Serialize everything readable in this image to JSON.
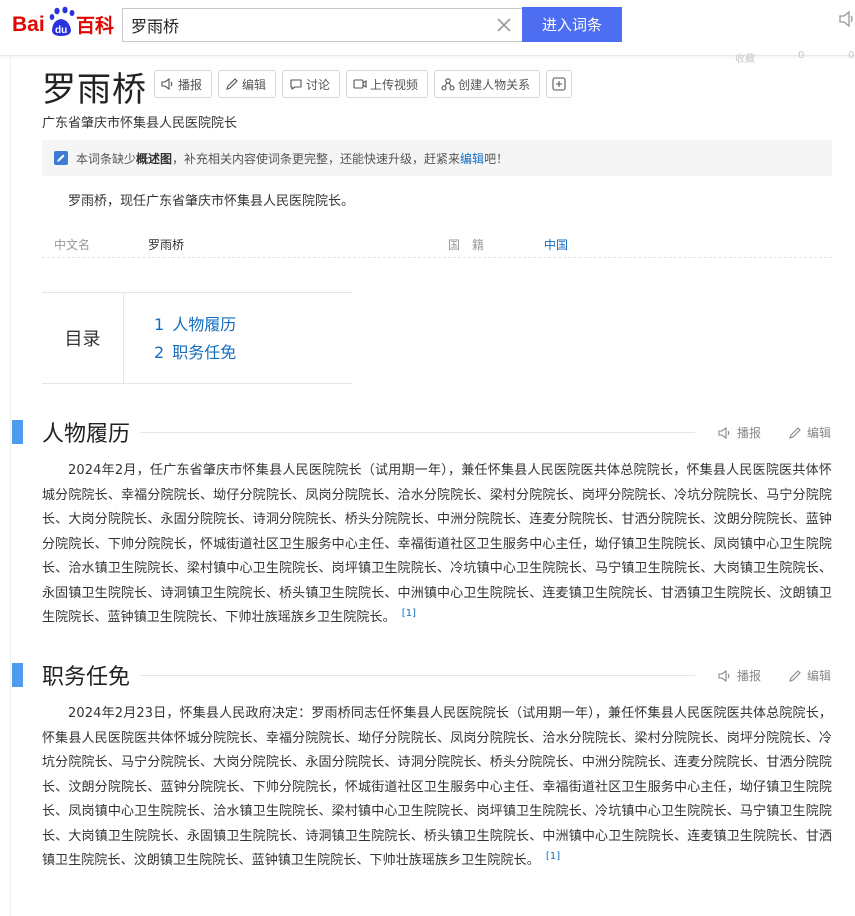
{
  "header": {
    "logo_text_bai": "Bai",
    "logo_text_du": "du",
    "logo_text_baike": "百科",
    "search_value": "罗雨桥",
    "enter_button": "进入词条"
  },
  "top_faint": {
    "collect": "收藏",
    "like_count": "0",
    "share_count": "0"
  },
  "entry": {
    "title": "罗雨桥",
    "tools": [
      "播报",
      "编辑",
      "讨论",
      "上传视频",
      "创建人物关系"
    ],
    "subtitle": "广东省肇庆市怀集县人民医院院长",
    "notice_pre": "本词条缺少",
    "notice_bold": "概述图",
    "notice_mid": "，补充相关内容使词条更完整，还能快速升级，赶紧来",
    "notice_link": "编辑",
    "notice_post": "吧！",
    "summary": "罗雨桥，现任广东省肇庆市怀集县人民医院院长。",
    "info": {
      "k1": "中文名",
      "v1": "罗雨桥",
      "k2": "国　籍",
      "v2": "中国"
    }
  },
  "toc": {
    "label": "目录",
    "items": [
      {
        "num": "1",
        "text": "人物履历"
      },
      {
        "num": "2",
        "text": "职务任免"
      }
    ]
  },
  "sections": [
    {
      "title": "人物履历",
      "actions": [
        "播报",
        "编辑"
      ],
      "text": "2024年2月，任广东省肇庆市怀集县人民医院院长（试用期一年），兼任怀集县人民医院医共体总院院长，怀集县人民医院医共体怀城分院院长、幸福分院院长、坳仔分院院长、凤岗分院院长、洽水分院院长、梁村分院院长、岗坪分院院长、冷坑分院院长、马宁分院院长、大岗分院院长、永固分院院长、诗洞分院院长、桥头分院院长、中洲分院院长、连麦分院院长、甘洒分院院长、汶朗分院院长、蓝钟分院院长、下帅分院院长，怀城街道社区卫生服务中心主任、幸福街道社区卫生服务中心主任，坳仔镇卫生院院长、凤岗镇中心卫生院院长、洽水镇卫生院院长、梁村镇中心卫生院院长、岗坪镇卫生院院长、冷坑镇中心卫生院院长、马宁镇卫生院院长、大岗镇卫生院院长、永固镇卫生院院长、诗洞镇卫生院院长、桥头镇卫生院院长、中洲镇中心卫生院院长、连麦镇卫生院院长、甘洒镇卫生院院长、汶朗镇卫生院院长、蓝钟镇卫生院院长、下帅壮族瑶族乡卫生院院长。",
      "ref": "[1]"
    },
    {
      "title": "职务任免",
      "actions": [
        "播报",
        "编辑"
      ],
      "text": "2024年2月23日，怀集县人民政府决定：罗雨桥同志任怀集县人民医院院长（试用期一年），兼任怀集县人民医院医共体总院院长，怀集县人民医院医共体怀城分院院长、幸福分院院长、坳仔分院院长、凤岗分院院长、洽水分院院长、梁村分院院长、岗坪分院院长、冷坑分院院长、马宁分院院长、大岗分院院长、永固分院院长、诗洞分院院长、桥头分院院长、中洲分院院长、连麦分院院长、甘洒分院院长、汶朗分院院长、蓝钟分院院长、下帅分院院长，怀城街道社区卫生服务中心主任、幸福街道社区卫生服务中心主任，坳仔镇卫生院院长、凤岗镇中心卫生院院长、洽水镇卫生院院长、梁村镇中心卫生院院长、岗坪镇卫生院院长、冷坑镇中心卫生院院长、马宁镇卫生院院长、大岗镇卫生院院长、永固镇卫生院院长、诗洞镇卫生院院长、桥头镇卫生院院长、中洲镇中心卫生院院长、连麦镇卫生院院长、甘洒镇卫生院院长、汶朗镇卫生院院长、蓝钟镇卫生院院长、下帅壮族瑶族乡卫生院院长。",
      "ref": "[1]"
    }
  ],
  "colors": {
    "brand_blue": "#4e6ef2",
    "logo_red": "#e10602",
    "link_blue": "#136ec2",
    "section_bar": "#4f9cee"
  }
}
